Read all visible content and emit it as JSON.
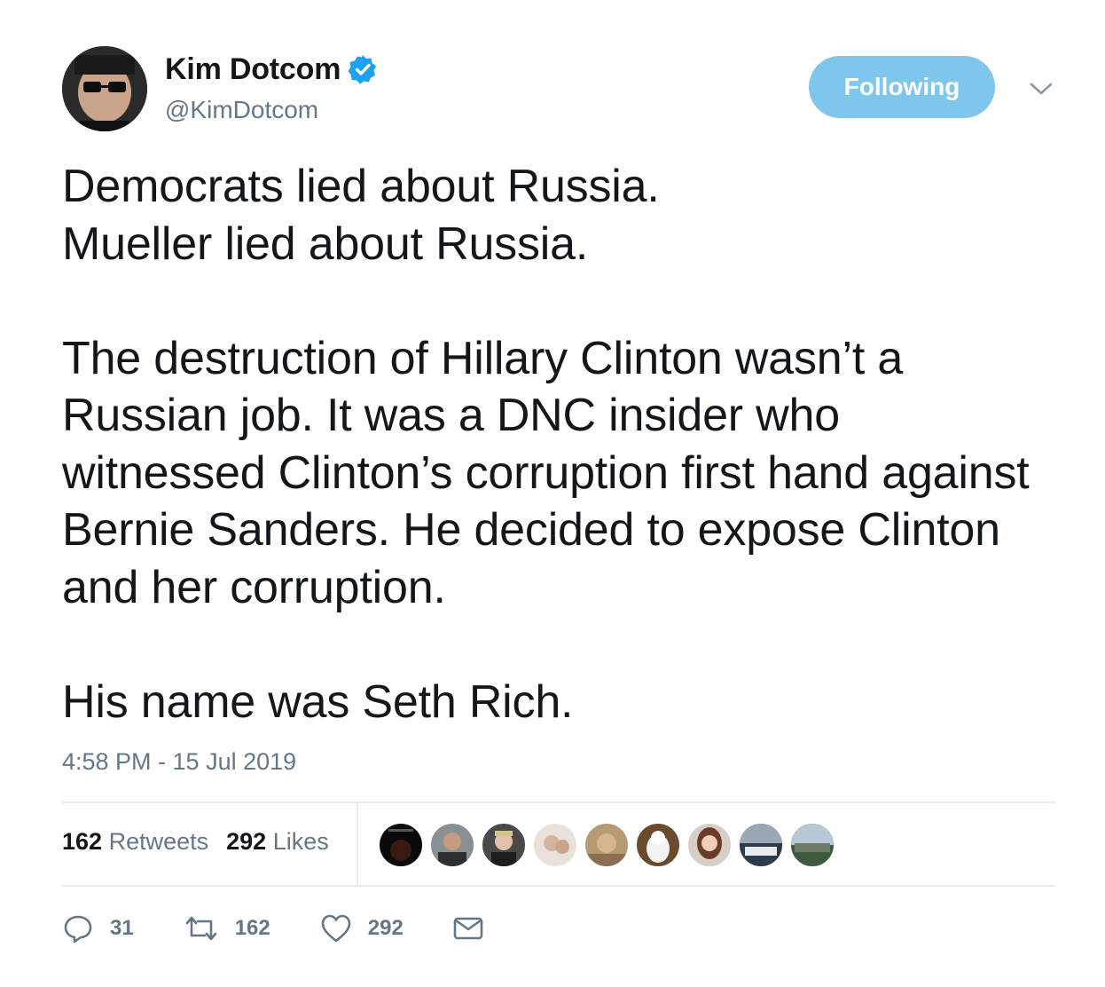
{
  "author": {
    "display_name": "Kim Dotcom",
    "handle": "@KimDotcom",
    "verified": true
  },
  "follow_button": {
    "label": "Following"
  },
  "tweet": {
    "text": "Democrats lied about Russia.\nMueller lied about Russia.\n\nThe destruction of Hillary Clinton wasn’t a Russian job. It was a DNC insider who witnessed Clinton’s corruption first hand against Bernie Sanders. He decided to expose Clinton and her corruption.\n\nHis name was Seth Rich.",
    "timestamp": "4:58 PM - 15 Jul 2019"
  },
  "stats": {
    "retweets": {
      "count": "162",
      "label": "Retweets"
    },
    "likes": {
      "count": "292",
      "label": "Likes"
    }
  },
  "liker_avatars": [
    "avatar-1",
    "avatar-2",
    "avatar-3",
    "avatar-4",
    "avatar-5",
    "avatar-6",
    "avatar-7",
    "avatar-8",
    "avatar-9"
  ],
  "actions": {
    "reply_count": "31",
    "retweet_count": "162",
    "like_count": "292"
  },
  "colors": {
    "accent": "#7fc6ec",
    "verified": "#1da1f2",
    "secondary_text": "#657786",
    "primary_text": "#14171a",
    "divider": "#e6ecf0"
  },
  "icons": {
    "verified": "verified-badge-icon",
    "menu": "chevron-down-icon",
    "reply": "reply-icon",
    "retweet": "retweet-icon",
    "like": "heart-icon",
    "message": "envelope-icon"
  }
}
